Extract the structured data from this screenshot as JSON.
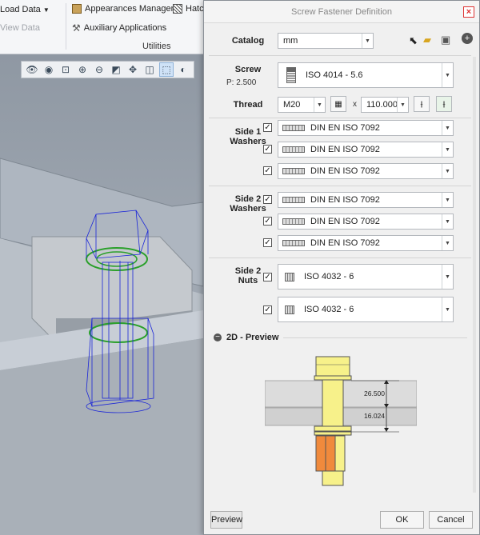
{
  "ribbon": {
    "load_data": "Load Data",
    "view_data": "View Data",
    "appearances_manager": "Appearances Manager",
    "hatch": "Hatc",
    "auxiliary_applications": "Auxiliary Applications",
    "utilities": "Utilities"
  },
  "dialog": {
    "title": "Screw Fastener Definition",
    "catalog": {
      "label": "Catalog",
      "value": "mm"
    },
    "screw": {
      "label": "Screw",
      "pitch": "P: 2.500",
      "value": "ISO 4014 - 5.6"
    },
    "thread": {
      "label": "Thread",
      "size": "M20",
      "times": "x",
      "length": "110.000"
    },
    "side1": {
      "label_line1": "Side 1",
      "label_line2": "Washers",
      "items": [
        "DIN EN ISO 7092",
        "DIN EN ISO 7092",
        "DIN EN ISO 7092"
      ]
    },
    "side2_washers": {
      "label_line1": "Side 2",
      "label_line2": "Washers",
      "items": [
        "DIN EN ISO 7092",
        "DIN EN ISO 7092",
        "DIN EN ISO 7092"
      ]
    },
    "side2_nuts": {
      "label_line1": "Side 2",
      "label_line2": "Nuts",
      "items": [
        "ISO 4032 - 6",
        "ISO 4032 - 6"
      ]
    },
    "preview_section": {
      "title": "2D - Preview",
      "collapse_symbol": "−",
      "dim1": "26.500",
      "dim2": "16.024"
    },
    "buttons": {
      "preview": "Preview",
      "ok": "OK",
      "cancel": "Cancel"
    }
  },
  "colors": {
    "bolt": "#f7f18a",
    "nut": "#f08a3c",
    "plate": "#dcdcdc",
    "accent": "#d33"
  }
}
